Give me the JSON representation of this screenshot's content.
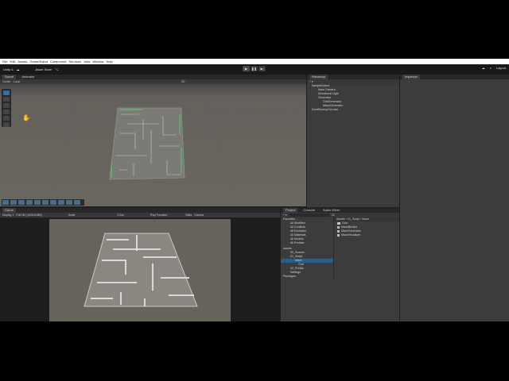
{
  "menu": [
    "File",
    "Edit",
    "Assets",
    "GameObject",
    "Component",
    "Services",
    "Jobs",
    "Window",
    "Help"
  ],
  "toolbar": {
    "account": "Unity 6",
    "asset_store": "Asset Store",
    "play": "▶",
    "pause": "❚❚",
    "step": "▶|",
    "layout": "Layout"
  },
  "scene": {
    "tabs": [
      "Scene",
      "Animator"
    ],
    "sub": [
      "Center",
      "Local"
    ],
    "mode": "2D"
  },
  "hierarchy": {
    "title": "Hierarchy",
    "items": [
      "SampleScene",
      "Main Camera",
      "Directional Light",
      "Generator",
      "GridGenerator",
      "MazeGenerator",
      "DontDestroyOnLoad"
    ]
  },
  "inspector": {
    "title": "Inspector"
  },
  "game": {
    "tabs": [
      "Game"
    ],
    "display": "Display 1",
    "resolution": "Full HD (1920x1080)",
    "scale_label": "Scale",
    "scale_value": "0.24x",
    "play_focused": "Play Focused",
    "stats": "Stats",
    "gizmos": "Gizmos"
  },
  "project": {
    "tabs": [
      "Project",
      "Console",
      "Audio Mixer"
    ],
    "breadcrumb": [
      "Assets",
      "01_Script",
      "Maze"
    ],
    "favorites_label": "Favorites",
    "favorites": [
      "All Modified",
      "All Conflicts",
      "All Excluded",
      "All Materials",
      "All Models",
      "All Prefabs"
    ],
    "assets_label": "Assets",
    "tree": [
      "00_Scenes",
      "01_Script",
      "Maze",
      "Grid",
      "02_Prefab",
      "Settings"
    ],
    "packages_label": "Packages",
    "files": [
      "Grid",
      "MazeBuilder",
      "MazeGenerator",
      "MazeVisualizer"
    ],
    "count": "22"
  }
}
